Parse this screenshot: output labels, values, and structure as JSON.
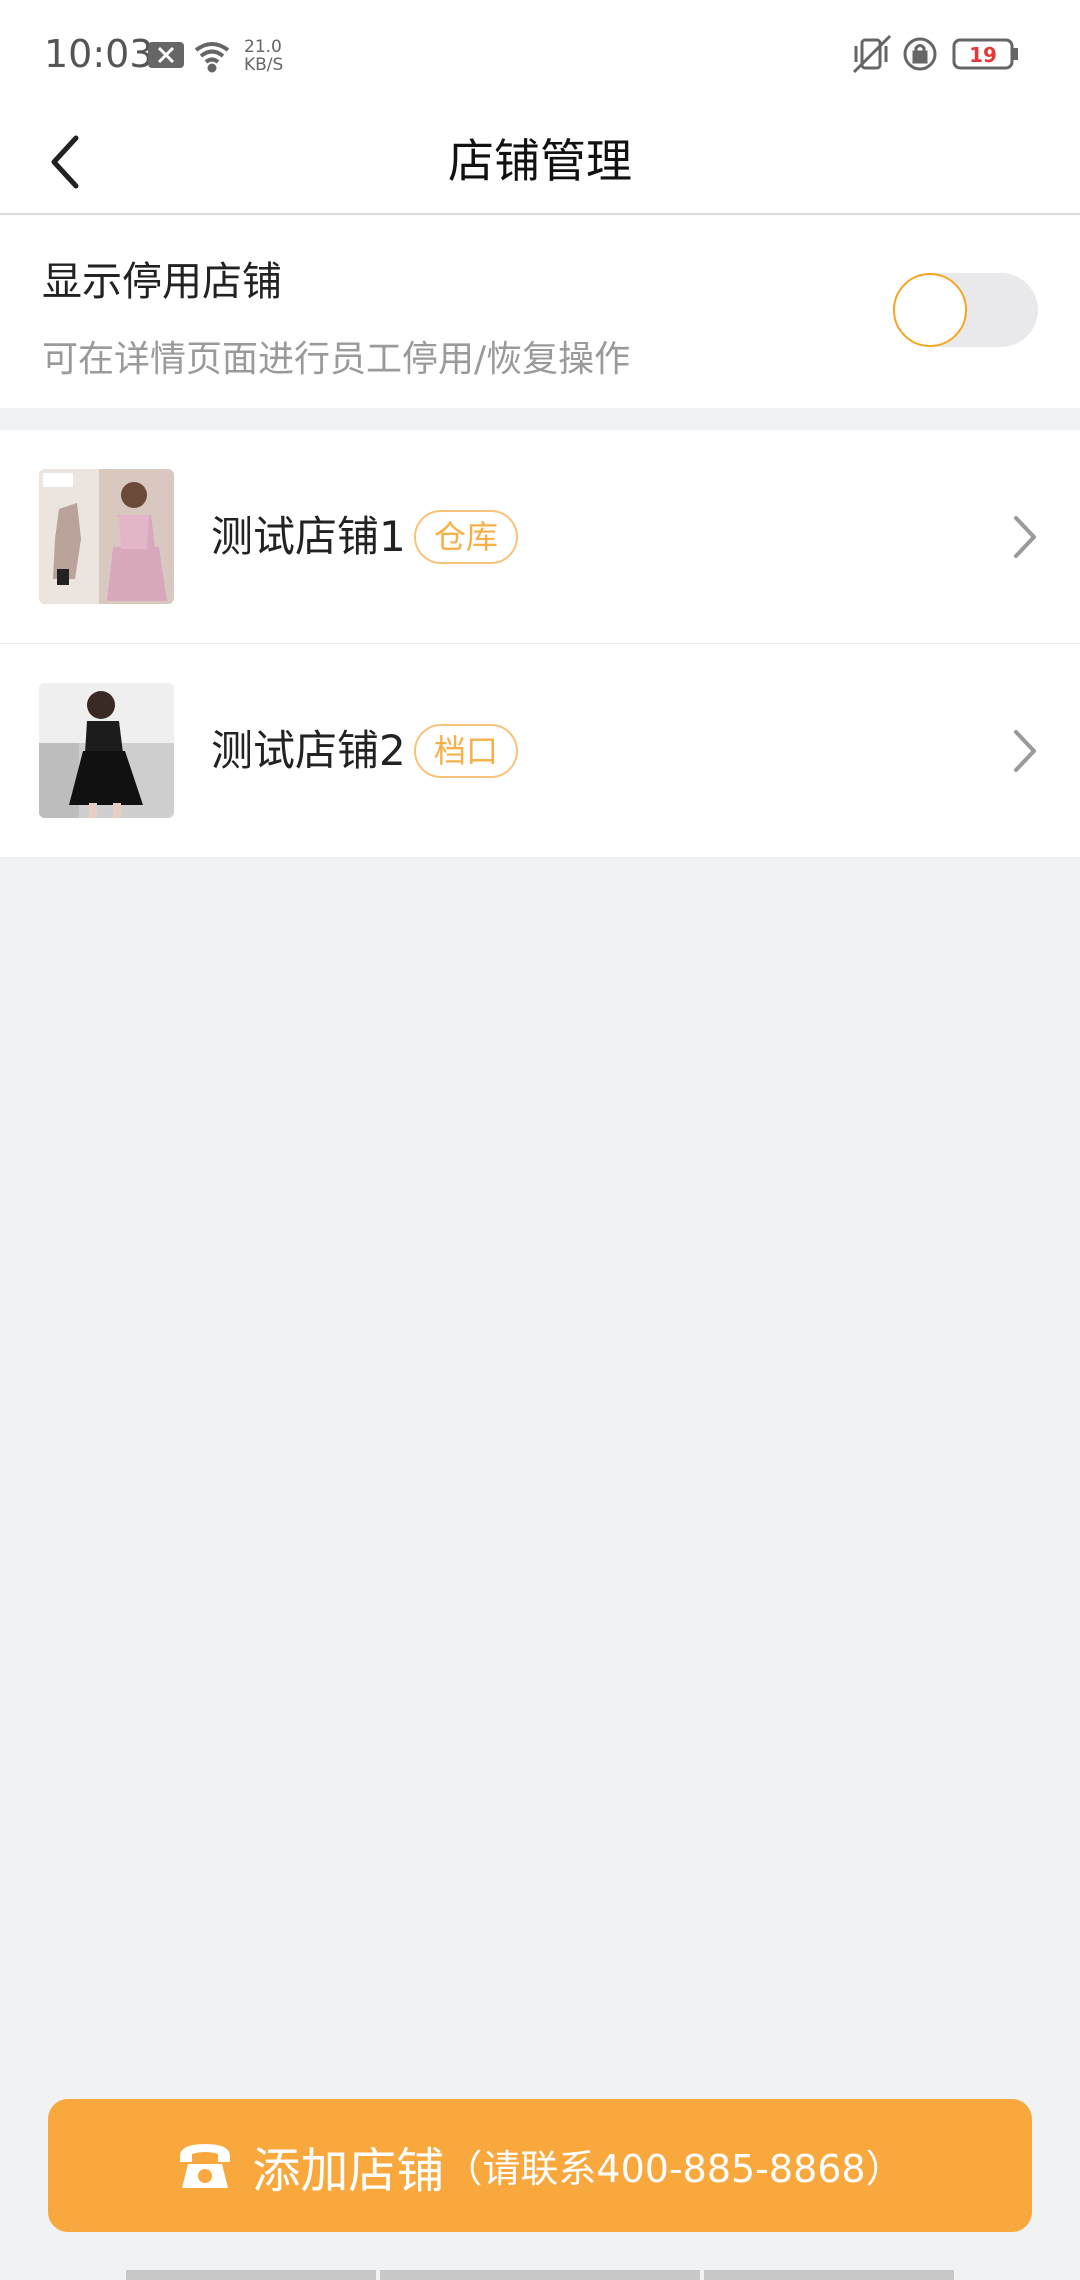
{
  "status_bar": {
    "time": "10:03",
    "net_speed_value": "21.0",
    "net_speed_unit": "KB/S",
    "battery": "19",
    "icons": [
      "close-notification-icon",
      "wifi-icon",
      "vibrate-icon",
      "rotation-lock-icon",
      "battery-icon"
    ]
  },
  "header": {
    "title": "店铺管理",
    "back_icon": "chevron-left-icon"
  },
  "toggle_section": {
    "title": "显示停用店铺",
    "subtitle": "可在详情页面进行员工停用/恢复操作",
    "enabled": false,
    "accent": "#f5a623"
  },
  "stores": [
    {
      "name": "测试店铺1",
      "tag": "仓库"
    },
    {
      "name": "测试店铺2",
      "tag": "档口"
    }
  ],
  "footer": {
    "button_label": "添加店铺",
    "button_sub": "（请联系400-885-8868）",
    "icon": "phone-icon",
    "color": "#f8a83c"
  }
}
